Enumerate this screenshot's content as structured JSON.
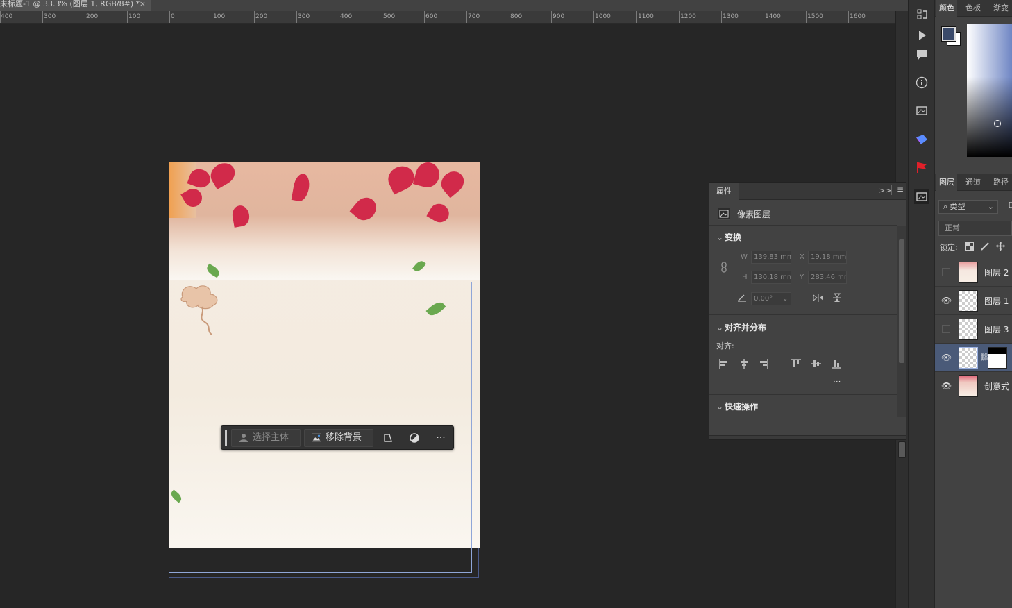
{
  "document_tab": {
    "title": "未标题-1 @ 33.3% (图层 1, RGB/8#) *",
    "close": "×"
  },
  "ruler": {
    "labels": [
      "400",
      "300",
      "200",
      "100",
      "0",
      "100",
      "200",
      "300",
      "400",
      "500",
      "600",
      "700",
      "800",
      "900",
      "1000",
      "1100",
      "1200",
      "1300",
      "1400",
      "1500",
      "1600"
    ]
  },
  "context_bar": {
    "select_subject": "选择主体",
    "remove_background": "移除背景",
    "more": "···"
  },
  "properties": {
    "tab": "属性",
    "layer_type": "像素图层",
    "transform": {
      "title": "变换",
      "w_label": "W",
      "w_value": "139.83 mm",
      "x_label": "X",
      "x_value": "19.18 mm",
      "h_label": "H",
      "h_value": "130.18 mm",
      "y_label": "Y",
      "y_value": "283.46 mm",
      "angle_value": "0.00°"
    },
    "align": {
      "title": "对齐并分布",
      "label": "对齐:",
      "more": "···"
    },
    "quick_actions": {
      "title": "快速操作"
    }
  },
  "right_panel": {
    "color_tabs": [
      "颜色",
      "色板",
      "渐变"
    ],
    "layer_tabs": [
      "图层",
      "通道",
      "路径"
    ],
    "filter_kind": "类型",
    "blend_mode": "正常",
    "lock_label": "锁定:",
    "layers": [
      {
        "name": "图层 2",
        "visible": false,
        "selected": false
      },
      {
        "name": "图层 1",
        "visible": true,
        "selected": false
      },
      {
        "name": "图层 3",
        "visible": false,
        "selected": false
      },
      {
        "name": "",
        "visible": true,
        "selected": true
      },
      {
        "name": "创意式",
        "visible": true,
        "selected": false
      }
    ]
  },
  "colors": {
    "accent": "#4a5a78",
    "foreground": "#3a4a6a",
    "background": "#ffffff"
  }
}
